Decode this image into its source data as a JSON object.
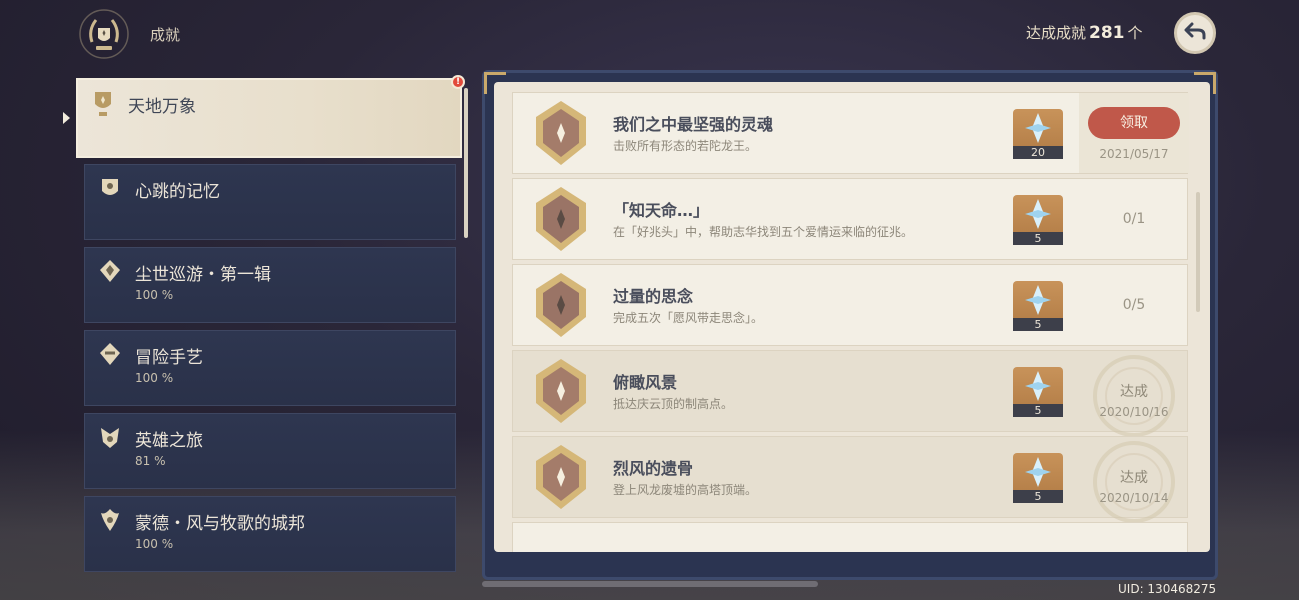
{
  "header": {
    "title": "成就",
    "count_label": "达成成就",
    "count": "281",
    "count_unit": "个"
  },
  "categories": [
    {
      "name": "天地万象",
      "percent": "",
      "active": true
    },
    {
      "name": "心跳的记忆",
      "percent": ""
    },
    {
      "name": "尘世巡游・第一辑",
      "percent": "100 %"
    },
    {
      "name": "冒险手艺",
      "percent": "100 %"
    },
    {
      "name": "英雄之旅",
      "percent": "81 %"
    },
    {
      "name": "蒙德・风与牧歌的城邦",
      "percent": "100 %"
    }
  ],
  "alert_badge": "!",
  "achievements": [
    {
      "title": "我们之中最坚强的灵魂",
      "desc": "击败所有形态的若陀龙王。",
      "reward_qty": "20",
      "status": "claim",
      "claim_label": "领取",
      "date": "2021/05/17"
    },
    {
      "title": "「知天命…」",
      "desc": "在「好兆头」中，帮助志华找到五个爱情运来临的征兆。",
      "reward_qty": "5",
      "status": "progress",
      "progress": "0/1"
    },
    {
      "title": "过量的思念",
      "desc": "完成五次「愿风带走思念」。",
      "reward_qty": "5",
      "status": "progress",
      "progress": "0/5"
    },
    {
      "title": "俯瞰风景",
      "desc": "抵达庆云顶的制高点。",
      "reward_qty": "5",
      "status": "done",
      "done_label": "达成",
      "date": "2020/10/16"
    },
    {
      "title": "烈风的遗骨",
      "desc": "登上风龙废墟的高塔顶端。",
      "reward_qty": "5",
      "status": "done",
      "done_label": "达成",
      "date": "2020/10/14"
    }
  ],
  "uid": "UID: 130468275",
  "colors": {
    "accent_claim": "#c0584a",
    "paper": "#ece5d8",
    "panel_dark": "#2b3451"
  },
  "icons": {
    "logo": "achievement-wreath-icon",
    "back": "back-arrow-icon",
    "reward": "primogem-icon",
    "medal": "achievement-medal-icon"
  }
}
